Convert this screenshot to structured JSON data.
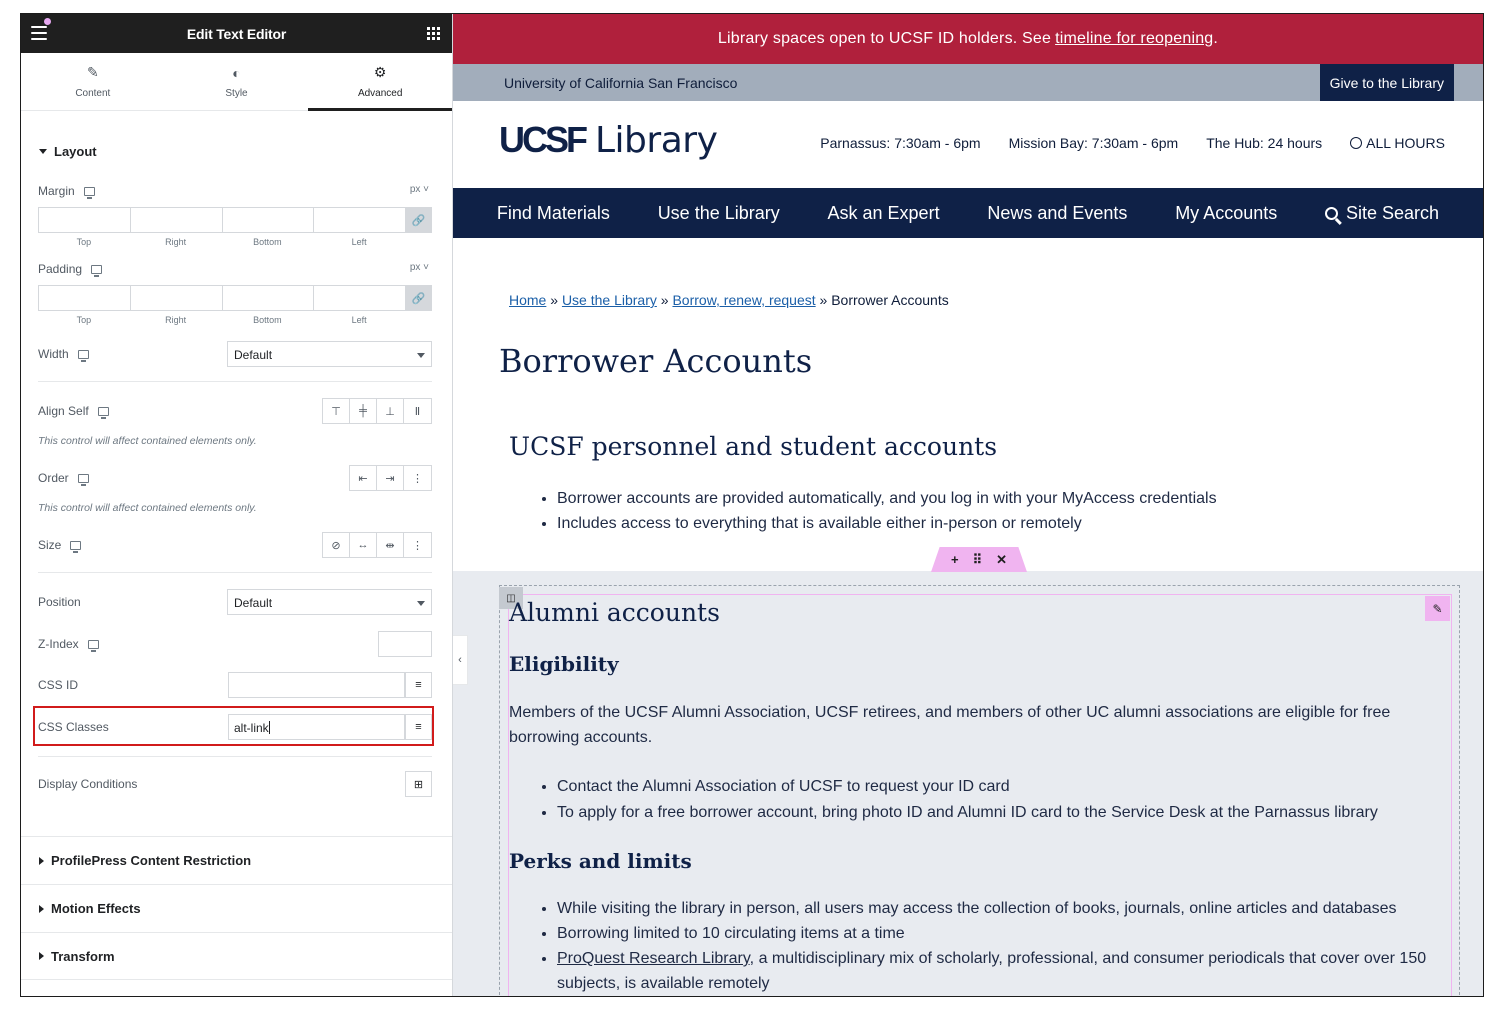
{
  "panel": {
    "title": "Edit Text Editor",
    "tabs": [
      {
        "label": "Content",
        "icon": "pencil-icon"
      },
      {
        "label": "Style",
        "icon": "half-circle-icon"
      },
      {
        "label": "Advanced",
        "icon": "gear-icon",
        "active": true
      }
    ],
    "layout": {
      "heading": "Layout",
      "margin_label": "Margin",
      "padding_label": "Padding",
      "unit": "px ˅",
      "dim_labels": [
        "Top",
        "Right",
        "Bottom",
        "Left"
      ],
      "width_label": "Width",
      "width_value": "Default",
      "align_self_label": "Align Self",
      "align_note": "This control will affect contained elements only.",
      "order_label": "Order",
      "order_note": "This control will affect contained elements only.",
      "size_label": "Size",
      "position_label": "Position",
      "position_value": "Default",
      "zindex_label": "Z-Index",
      "cssid_label": "CSS ID",
      "cssid_value": "",
      "cssclasses_label": "CSS Classes",
      "cssclasses_value": "alt-link",
      "display_conditions_label": "Display Conditions"
    },
    "collapsed_sections": [
      "ProfilePress Content Restriction",
      "Motion Effects",
      "Transform"
    ]
  },
  "site": {
    "alert_text": "Library spaces open to UCSF ID holders. See",
    "alert_link": "timeline for reopening",
    "alert_end": ".",
    "university": "University of California San Francisco",
    "give_button": "Give to the Library",
    "logo_mark": "UCSF",
    "logo_text": "Library",
    "hours": [
      "Parnassus: 7:30am - 6pm",
      "Mission Bay: 7:30am - 6pm",
      "The Hub: 24 hours"
    ],
    "all_hours": "ALL HOURS",
    "nav": [
      "Find Materials",
      "Use the Library",
      "Ask an Expert",
      "News and Events",
      "My Accounts",
      "Site Search"
    ],
    "breadcrumbs": {
      "home": "Home",
      "use": "Use the Library",
      "borrow": "Borrow, renew, request",
      "current": "Borrower Accounts"
    },
    "page_title": "Borrower Accounts",
    "section1_title": "UCSF personnel and student accounts",
    "section1_bullets": [
      "Borrower accounts are provided automatically, and you log in with your MyAccess credentials",
      "Includes access to everything that is available either in-person or remotely"
    ],
    "section2_title": "Alumni accounts",
    "eligibility_heading": "Eligibility",
    "eligibility_text": "Members of the UCSF Alumni Association, UCSF retirees, and members of other UC alumni associations are eligible for free borrowing accounts.",
    "eligibility_bullets": [
      "Contact the Alumni Association of UCSF to request your ID card",
      "To apply for a free borrower account, bring photo ID and Alumni ID card to the Service Desk at the Parnassus library"
    ],
    "perks_heading": "Perks and limits",
    "perks_bullets": [
      "While visiting the library in person, all users may access the collection of books, journals, online articles and databases",
      "Borrowing limited to 10 circulating items at a time"
    ],
    "perks_link": "ProQuest Research Library",
    "perks_link_rest": ", a multidisciplinary mix of scholarly, professional, and consumer periodicals that cover over 150 subjects, is available remotely"
  }
}
